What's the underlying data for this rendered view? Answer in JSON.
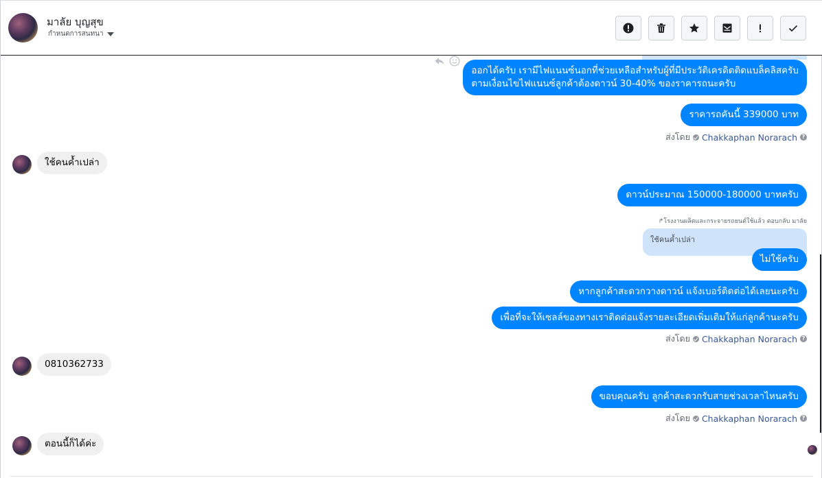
{
  "header": {
    "contact_name": "มาลัย บุญสุข",
    "status_label": "กำหนดการสนทนา"
  },
  "toolbar": {
    "buttons": [
      {
        "name": "report-button",
        "icon": "alert-circle-icon"
      },
      {
        "name": "delete-button",
        "icon": "trash-icon"
      },
      {
        "name": "star-button",
        "icon": "star-icon"
      },
      {
        "name": "mark-unread-button",
        "icon": "envelope-icon"
      },
      {
        "name": "important-button",
        "icon": "exclamation-icon"
      },
      {
        "name": "done-button",
        "icon": "checkmark-icon"
      }
    ]
  },
  "messages": {
    "out_1_line1": "ออกได้ครับ เรามีไฟแนนซ์นอกที่ช่วยเหลือสำหรับผู้ที่มีประวัติเครดิตติดแบล็คลิสครับ",
    "out_1_line2": "ตามเงื่อนไขไฟแนนซ์ลูกค้าต้องดาวน์ 30-40% ของราคารถนะครับ",
    "out_2": "ราคารถคันนี้ 339000 บาท",
    "sent_by_label": "ส่งโดย",
    "sent_by_name": "Chakkaphan Norarach",
    "in_1": "ใช้คนค้ำเปล่า",
    "out_3": "ดาวน์ประมาณ 150000-180000 บาทครับ",
    "reply_note": "↱โรงงานผลิตและกระจายรถยนต์ใช้แล้ว ตอบกลับ มาลัย",
    "quoted_text": "ใช้คนค้ำเปล่า",
    "out_4": "ไม่ใช้ครับ",
    "out_5": "หากลูกค้าสะดวกวางดาวน์ แจ้งเบอร์ติดต่อได้เลยนะครับ",
    "out_6": "เพื่อที่จะให้เซลล์ของทางเราติดต่อแจ้งรายละเอียดเพิ่มเติมให้แก่ลูกค้านะครับ",
    "in_2": "0810362733",
    "out_7": "ขอบคุณครับ ลูกค้าสะดวกรับสายช่วงเวลาไหนครับ",
    "in_3": "ตอนนี้ก็ได้ค่ะ"
  },
  "colors": {
    "outgoing_bubble": "#0084ff",
    "incoming_bubble": "#f0f0f0",
    "link_name": "#385898"
  }
}
